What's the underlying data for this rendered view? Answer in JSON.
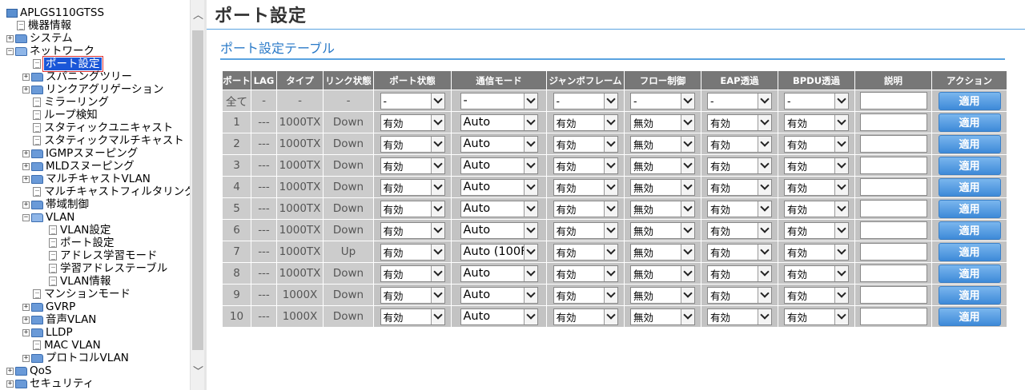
{
  "sidebar": {
    "root_label": "APLGS110GTSS",
    "items": [
      {
        "label": "機器情報",
        "type": "doc",
        "level": 1
      },
      {
        "label": "システム",
        "type": "folder",
        "level": 1,
        "expander": "+"
      },
      {
        "label": "ネットワーク",
        "type": "folder-open",
        "level": 1,
        "expander": "−"
      },
      {
        "label": "ポート設定",
        "type": "doc",
        "level": 2,
        "selected": true
      },
      {
        "label": "スパニングツリー",
        "type": "folder",
        "level": 2,
        "expander": "+"
      },
      {
        "label": "リンクアグリゲーション",
        "type": "folder",
        "level": 2,
        "expander": "+"
      },
      {
        "label": "ミラーリング",
        "type": "doc",
        "level": 2
      },
      {
        "label": "ループ検知",
        "type": "doc",
        "level": 2
      },
      {
        "label": "スタティックユニキャスト",
        "type": "doc",
        "level": 2
      },
      {
        "label": "スタティックマルチキャスト",
        "type": "doc",
        "level": 2
      },
      {
        "label": "IGMPスヌーピング",
        "type": "folder",
        "level": 2,
        "expander": "+"
      },
      {
        "label": "MLDスヌーピング",
        "type": "folder",
        "level": 2,
        "expander": "+"
      },
      {
        "label": "マルチキャストVLAN",
        "type": "folder",
        "level": 2,
        "expander": "+"
      },
      {
        "label": "マルチキャストフィルタリング",
        "type": "doc",
        "level": 2
      },
      {
        "label": "帯域制御",
        "type": "folder",
        "level": 2,
        "expander": "+"
      },
      {
        "label": "VLAN",
        "type": "folder-open",
        "level": 2,
        "expander": "−"
      },
      {
        "label": "VLAN設定",
        "type": "doc",
        "level": 3
      },
      {
        "label": "ポート設定",
        "type": "doc",
        "level": 3
      },
      {
        "label": "アドレス学習モード",
        "type": "doc",
        "level": 3
      },
      {
        "label": "学習アドレステーブル",
        "type": "doc",
        "level": 3
      },
      {
        "label": "VLAN情報",
        "type": "doc",
        "level": 3
      },
      {
        "label": "マンションモード",
        "type": "doc",
        "level": 2
      },
      {
        "label": "GVRP",
        "type": "folder",
        "level": 2,
        "expander": "+"
      },
      {
        "label": "音声VLAN",
        "type": "folder",
        "level": 2,
        "expander": "+"
      },
      {
        "label": "LLDP",
        "type": "folder",
        "level": 2,
        "expander": "+"
      },
      {
        "label": "MAC VLAN",
        "type": "doc",
        "level": 2
      },
      {
        "label": "プロトコルVLAN",
        "type": "folder",
        "level": 2,
        "expander": "+"
      },
      {
        "label": "QoS",
        "type": "folder",
        "level": 1,
        "expander": "+"
      },
      {
        "label": "セキュリティ",
        "type": "folder",
        "level": 1,
        "expander": "+"
      }
    ]
  },
  "page": {
    "title": "ポート設定",
    "table_title": "ポート設定テーブル"
  },
  "table": {
    "headers": [
      "ポート",
      "LAG",
      "タイプ",
      "リンク状態",
      "ポート状態",
      "通信モード",
      "ジャンボフレーム",
      "フロー制御",
      "EAP透過",
      "BPDU透過",
      "説明",
      "アクション"
    ],
    "all_row": {
      "port": "全て",
      "lag": "-",
      "type": "-",
      "link": "-",
      "port_state": "-",
      "comm_mode": "-",
      "jumbo": "-",
      "flow": "-",
      "eap": "-",
      "bpdu": "-",
      "action": "適用"
    },
    "rows": [
      {
        "port": "1",
        "lag": "---",
        "type": "1000TX",
        "link": "Down",
        "port_state": "有効",
        "comm_mode": "Auto",
        "jumbo": "有効",
        "flow": "無効",
        "eap": "有効",
        "bpdu": "有効",
        "action": "適用"
      },
      {
        "port": "2",
        "lag": "---",
        "type": "1000TX",
        "link": "Down",
        "port_state": "有効",
        "comm_mode": "Auto",
        "jumbo": "有効",
        "flow": "無効",
        "eap": "有効",
        "bpdu": "有効",
        "action": "適用"
      },
      {
        "port": "3",
        "lag": "---",
        "type": "1000TX",
        "link": "Down",
        "port_state": "有効",
        "comm_mode": "Auto",
        "jumbo": "有効",
        "flow": "無効",
        "eap": "有効",
        "bpdu": "有効",
        "action": "適用"
      },
      {
        "port": "4",
        "lag": "---",
        "type": "1000TX",
        "link": "Down",
        "port_state": "有効",
        "comm_mode": "Auto",
        "jumbo": "有効",
        "flow": "無効",
        "eap": "有効",
        "bpdu": "有効",
        "action": "適用"
      },
      {
        "port": "5",
        "lag": "---",
        "type": "1000TX",
        "link": "Down",
        "port_state": "有効",
        "comm_mode": "Auto",
        "jumbo": "有効",
        "flow": "無効",
        "eap": "有効",
        "bpdu": "有効",
        "action": "適用"
      },
      {
        "port": "6",
        "lag": "---",
        "type": "1000TX",
        "link": "Down",
        "port_state": "有効",
        "comm_mode": "Auto",
        "jumbo": "有効",
        "flow": "無効",
        "eap": "有効",
        "bpdu": "有効",
        "action": "適用"
      },
      {
        "port": "7",
        "lag": "---",
        "type": "1000TX",
        "link": "Up",
        "port_state": "有効",
        "comm_mode": "Auto (100F",
        "jumbo": "有効",
        "flow": "無効",
        "eap": "有効",
        "bpdu": "有効",
        "action": "適用"
      },
      {
        "port": "8",
        "lag": "---",
        "type": "1000TX",
        "link": "Down",
        "port_state": "有効",
        "comm_mode": "Auto",
        "jumbo": "有効",
        "flow": "無効",
        "eap": "有効",
        "bpdu": "有効",
        "action": "適用"
      },
      {
        "port": "9",
        "lag": "---",
        "type": "1000X",
        "link": "Down",
        "port_state": "有効",
        "comm_mode": "Auto",
        "jumbo": "有効",
        "flow": "無効",
        "eap": "有効",
        "bpdu": "有効",
        "action": "適用"
      },
      {
        "port": "10",
        "lag": "---",
        "type": "1000X",
        "link": "Down",
        "port_state": "有効",
        "comm_mode": "Auto",
        "jumbo": "有効",
        "flow": "無効",
        "eap": "有効",
        "bpdu": "有効",
        "action": "適用"
      }
    ]
  },
  "colors": {
    "header_bg": "#777777",
    "cell_bg": "#cccccc",
    "accent": "#2a7ac8",
    "button": "#4a94dc",
    "selected": "#1a56d8"
  }
}
